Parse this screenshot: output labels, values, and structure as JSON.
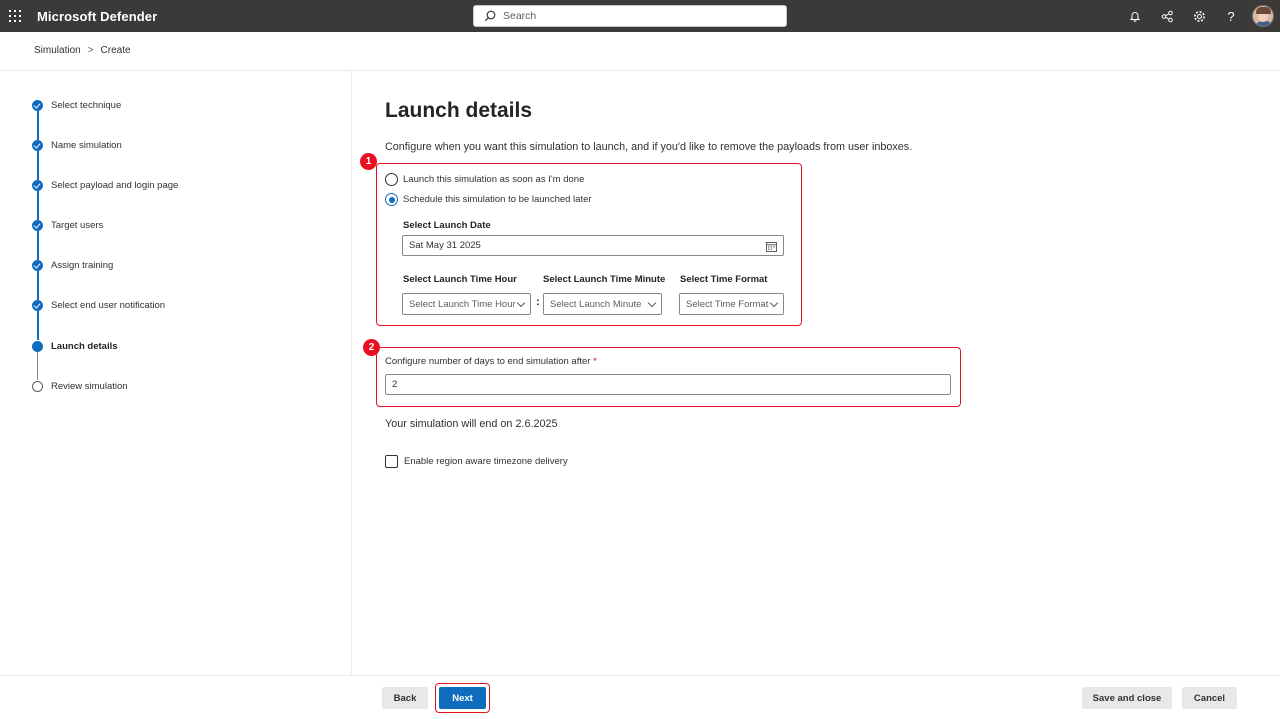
{
  "app": {
    "title": "Microsoft Defender"
  },
  "search": {
    "placeholder": "Search"
  },
  "topbar_icons": [
    "bell-icon",
    "share-icon",
    "gear-icon",
    "help-icon"
  ],
  "breadcrumb": {
    "items": [
      "Simulation",
      "Create"
    ],
    "separator": ">"
  },
  "steps": [
    {
      "label": "Select technique",
      "state": "done"
    },
    {
      "label": "Name simulation",
      "state": "done"
    },
    {
      "label": "Select payload and login page",
      "state": "done"
    },
    {
      "label": "Target users",
      "state": "done"
    },
    {
      "label": "Assign training",
      "state": "done"
    },
    {
      "label": "Select end user notification",
      "state": "done"
    },
    {
      "label": "Launch details",
      "state": "current"
    },
    {
      "label": "Review simulation",
      "state": "todo"
    }
  ],
  "main": {
    "title": "Launch details",
    "description": "Configure when you want this simulation to launch, and if you'd like to remove the payloads from user inboxes.",
    "annotations": [
      "1",
      "2"
    ],
    "launch_options": [
      {
        "label": "Launch this simulation as soon as I'm done",
        "checked": false
      },
      {
        "label": "Schedule this simulation to be launched later",
        "checked": true
      }
    ],
    "launch_date": {
      "label": "Select Launch Date",
      "value": "Sat May 31 2025"
    },
    "time_hour": {
      "label": "Select Launch Time Hour",
      "placeholder": "Select Launch Time Hour"
    },
    "time_colon": ":",
    "time_minute": {
      "label": "Select Launch Time Minute",
      "placeholder": "Select Launch Minute"
    },
    "time_format": {
      "label": "Select Time Format",
      "placeholder": "Select Time Format"
    },
    "days": {
      "label": "Configure number of days to end simulation after",
      "required_mark": "*",
      "value": "2"
    },
    "end_text": "Your simulation will end on 2.6.2025",
    "region_checkbox": {
      "label": "Enable region aware timezone delivery",
      "checked": false
    }
  },
  "footer": {
    "back_label": "Back",
    "next_label": "Next",
    "save_close_label": "Save and close",
    "cancel_label": "Cancel"
  },
  "colors": {
    "accent": "#0f6cbd",
    "annotation": "#e81123",
    "topbar": "#3b3a39"
  }
}
